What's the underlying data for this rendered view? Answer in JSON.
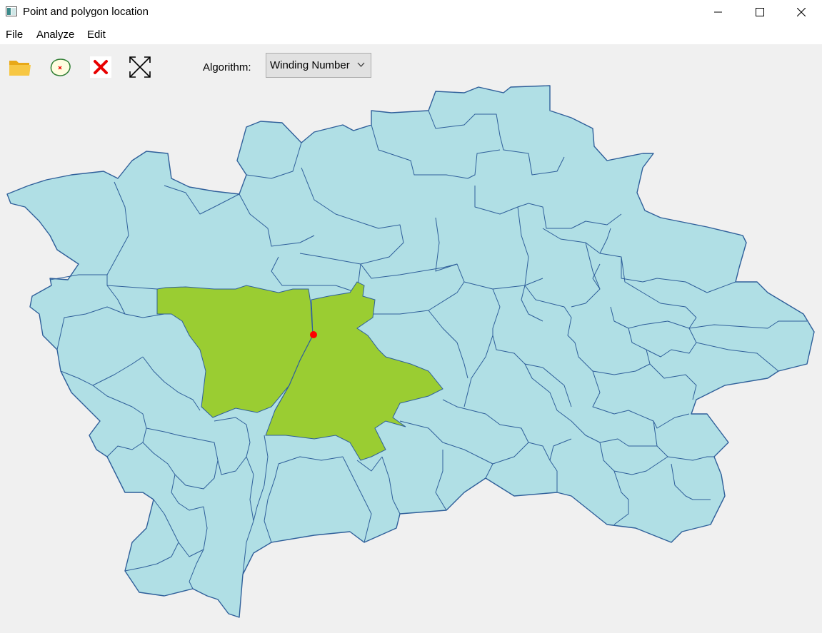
{
  "window": {
    "title": "Point and polygon location",
    "icon": "app-window-icon"
  },
  "menu": {
    "items": [
      {
        "label": "File"
      },
      {
        "label": "Analyze"
      },
      {
        "label": "Edit"
      }
    ]
  },
  "toolbar": {
    "tools": [
      {
        "icon": "folder-icon"
      },
      {
        "icon": "point-in-polygon-icon"
      },
      {
        "icon": "clear-icon"
      },
      {
        "icon": "fit-extent-icon"
      }
    ],
    "algorithm_label": "Algorithm:",
    "algorithm_value": "Winding Number"
  },
  "map": {
    "fill_color": "#b0dfe5",
    "stroke_color": "#2f5f9a",
    "highlight_color": "#9acd32",
    "point_color": "#ff0000",
    "selected_polygons": 2
  }
}
